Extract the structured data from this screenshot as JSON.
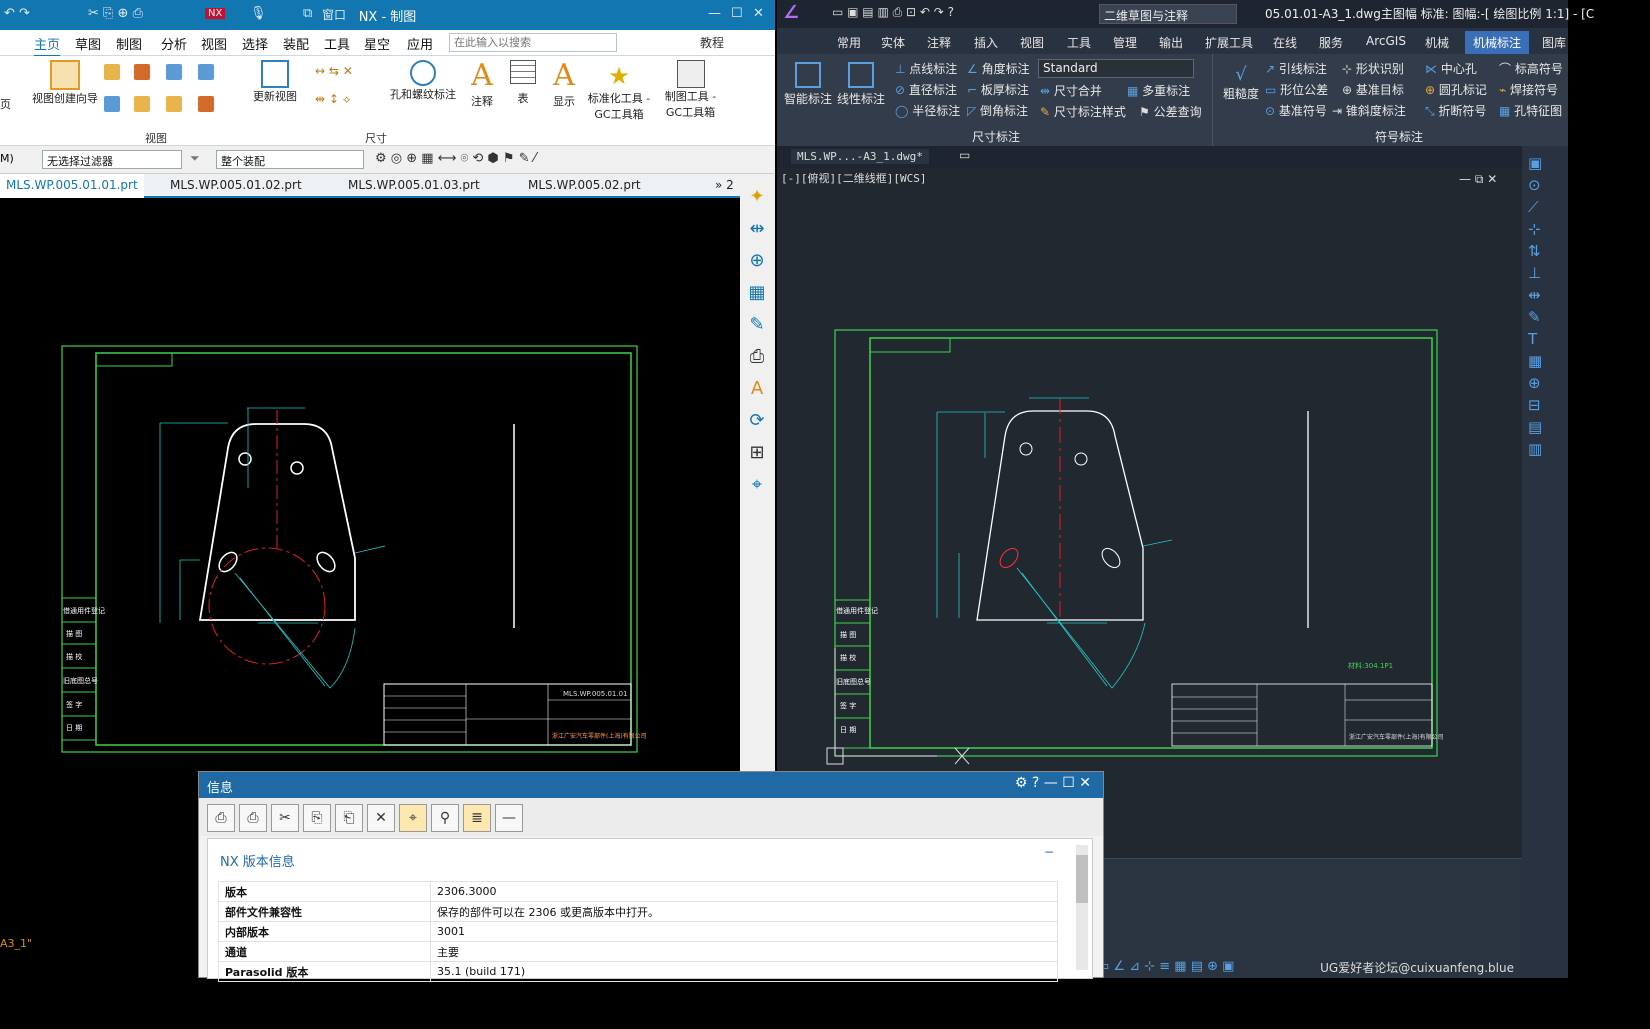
{
  "nx": {
    "title": "NX - 制图",
    "window_menu": "窗口",
    "menu": [
      "主页",
      "草图",
      "制图",
      "分析",
      "视图",
      "选择",
      "装配",
      "工具",
      "星空",
      "应用"
    ],
    "search_placeholder": "在此输入以搜索",
    "help_label": "教程",
    "ribbon": {
      "view_wizard": "视图创建向导",
      "update_view": "更新视图",
      "hole_thread": "孔和螺纹标注",
      "annotation": "注释",
      "table": "表",
      "display": "显示",
      "std_tools": "标准化工具 - GC工具箱",
      "drafting_tools": "制图工具 - GC工具箱",
      "group_view": "视图",
      "group_dim": "尺寸",
      "page": "页"
    },
    "filter": {
      "selection_filter": "无选择过滤器",
      "assembly": "整个装配",
      "prefix": "M)"
    },
    "file_tabs": [
      "MLS.WP.005.01.01.prt",
      "MLS.WP.005.01.02.prt",
      "MLS.WP.005.01.03.prt",
      "MLS.WP.005.02.prt"
    ],
    "more_tabs": "» 2",
    "status_text": "A3_1\"",
    "left_block_labels": [
      "借通用件登记",
      "描 图",
      "描 校",
      "旧底图总号",
      "签 字",
      "日 期"
    ],
    "title_block_text": "浙江广安汽车零部件(上海)有限公司",
    "drawing_number": "MLS.WP.005.01.01"
  },
  "zw": {
    "title": "05.01.01-A3_1.dwg主图幅 标准: 图幅:-[ 绘图比例 1:1] - [C",
    "workspace": "二维草图与注释",
    "menu": [
      "常用",
      "实体",
      "注释",
      "插入",
      "视图",
      "工具",
      "管理",
      "输出",
      "扩展工具",
      "在线",
      "服务",
      "ArcGIS",
      "机械",
      "机械标注",
      "图库"
    ],
    "active_tab": "机械标注",
    "dim_buttons": {
      "smart": "智能标注",
      "linear": "线性标注",
      "point": "点线标注",
      "diameter": "直径标注",
      "radius": "半径标注",
      "angle": "角度标注",
      "sheet_thick": "板厚标注",
      "chamfer": "倒角标注",
      "style": "Standard",
      "merge": "尺寸合并",
      "dim_style": "尺寸标注样式",
      "multi": "多重标注",
      "tolerance_query": "公差查询",
      "group": "尺寸标注"
    },
    "sym_buttons": {
      "roughness": "粗糙度",
      "leader": "引线标注",
      "form_tol": "形位公差",
      "datum_symbol": "基准符号",
      "shape_recog": "形状识别",
      "datum_target": "基准目标",
      "taper": "锥斜度标注",
      "center_hole": "中心孔",
      "hole_mark": "圆孔标记",
      "break_symbol": "折断符号",
      "elevation": "标高符号",
      "weld": "焊接符号",
      "hole_feature": "孔特征图",
      "group": "符号标注"
    },
    "doc_tab": "MLS.WP...-A3_1.dwg*",
    "viewport_label": "[-][俯视][二维线框][WCS]",
    "left_block_labels": [
      "借通用件登记",
      "描 图",
      "描 校",
      "旧底图总号",
      "签 字",
      "日 期"
    ],
    "title_block_text": "浙江广安汽车零部件(上海)有限公司",
    "material_text": "材料:304.1P1",
    "watermark": "UG爱好者论坛@cuixuanfeng.blue"
  },
  "info": {
    "title": "信息",
    "section": "NX 版本信息",
    "rows": [
      {
        "key": "版本",
        "value": "2306.3000"
      },
      {
        "key": "部件文件兼容性",
        "value": "保存的部件可以在 2306 或更高版本中打开。"
      },
      {
        "key": "内部版本",
        "value": "3001"
      },
      {
        "key": "通道",
        "value": "主要"
      },
      {
        "key": "Parasolid 版本",
        "value": "35.1 (build 171)"
      }
    ]
  }
}
